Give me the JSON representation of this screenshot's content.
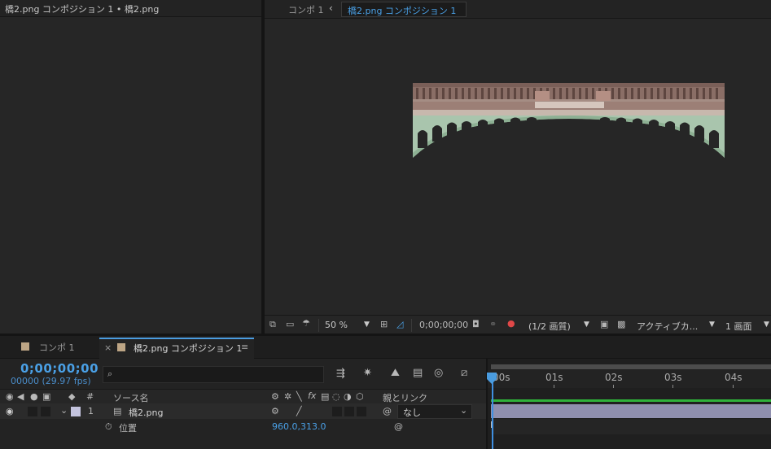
{
  "project_panel": {
    "title": "橋2.png コンポジション 1 • 橋2.png"
  },
  "viewer": {
    "breadcrumbs": [
      "コンポ 1",
      "橋2.png コンポジション 1"
    ],
    "toolbar": {
      "zoom": "50 %",
      "timecode": "0;00;00;00",
      "resolution": "(1/2 画質)",
      "camera": "アクティブカ...",
      "views": "1 画面"
    }
  },
  "timeline": {
    "tabs": [
      {
        "label": "コンポ 1"
      },
      {
        "label": "橋2.png コンポジション 1"
      }
    ],
    "close_symbol": "×",
    "menu_symbol": "≡",
    "current_time": "0;00;00;00",
    "frame_info": "00000 (29.97 fps)",
    "search_placeholder": "",
    "columns": {
      "number": "#",
      "source_name": "ソース名",
      "parent_link": "親とリンク"
    },
    "layer": {
      "number": "1",
      "name": "橋2.png",
      "parent": "なし"
    },
    "property": {
      "name": "位置",
      "value": "960.0,313.0"
    },
    "ruler_labels": [
      "00s",
      "01s",
      "02s",
      "03s",
      "04s"
    ],
    "colors": {
      "accent": "#4aa0e6",
      "layer_bar": "#8f8fae",
      "label_swatch": "#bda585",
      "work_green": "#2fb13a"
    }
  }
}
